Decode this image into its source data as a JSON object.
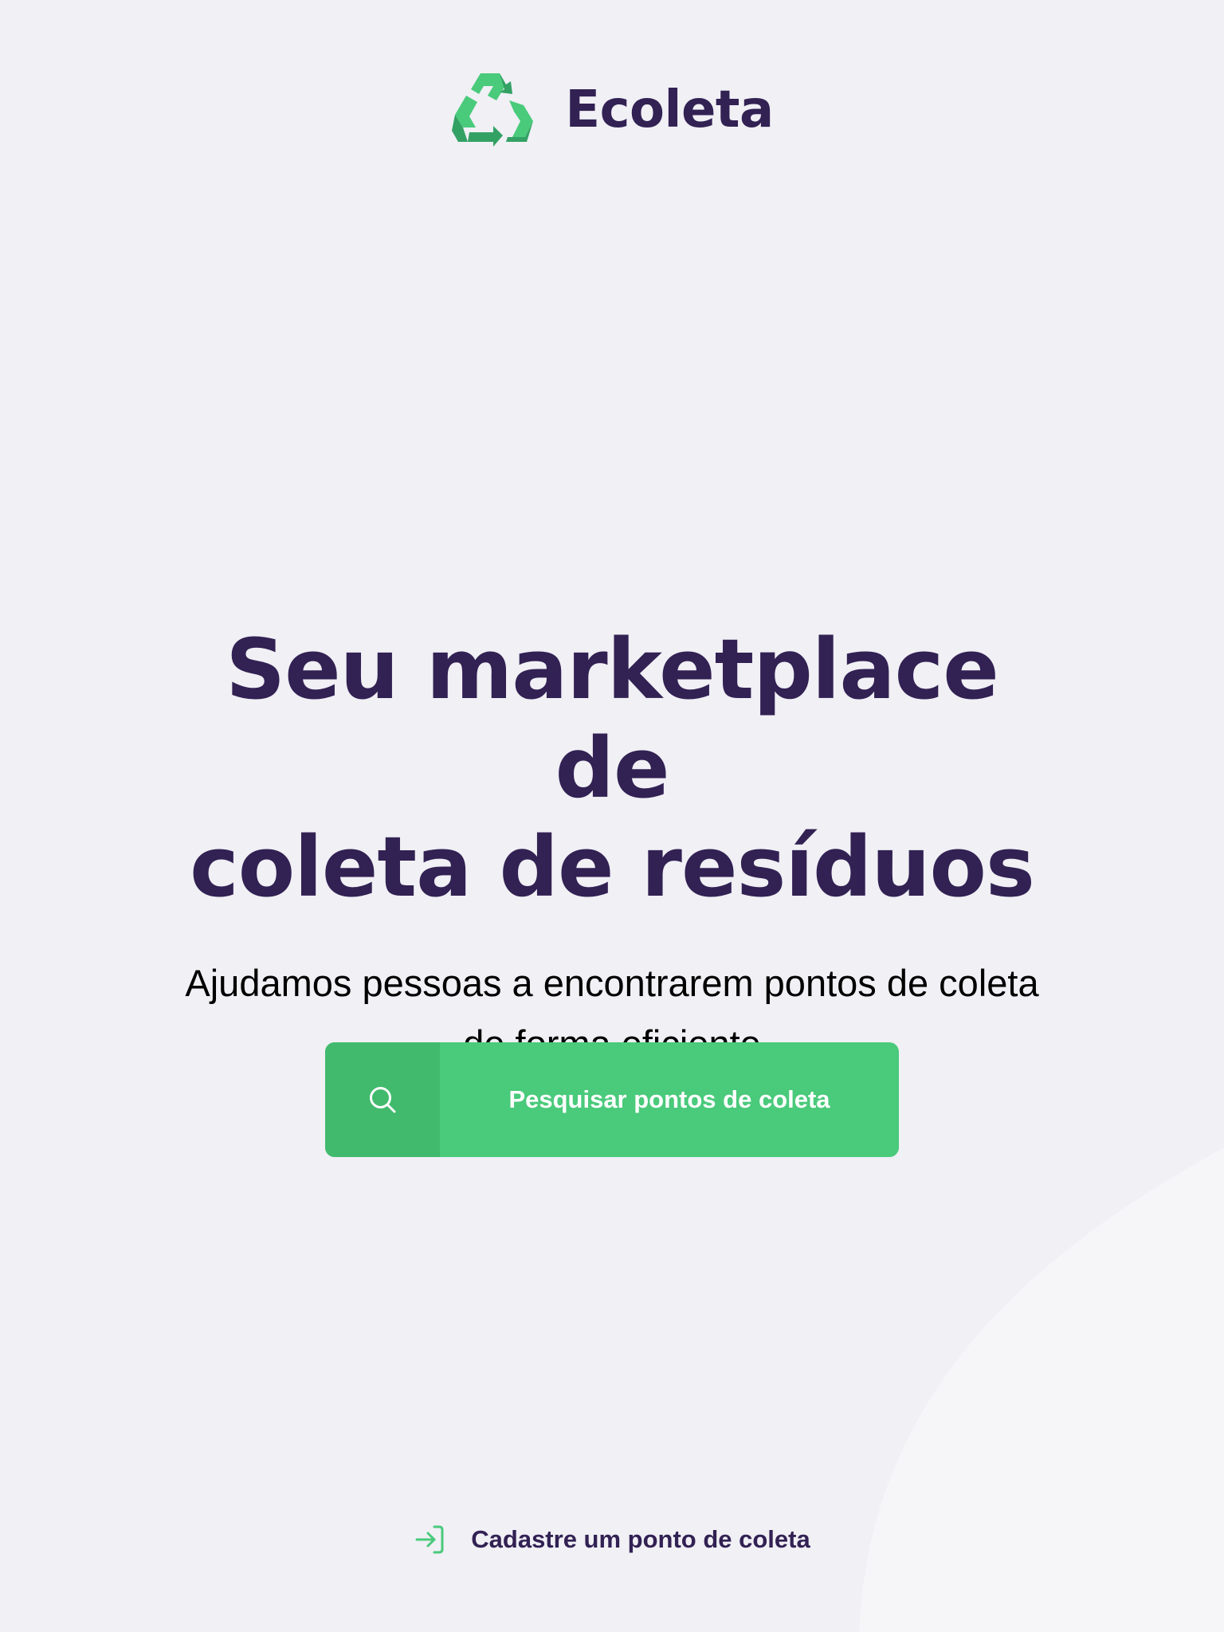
{
  "app": {
    "name": "Ecoleta",
    "logo_icon": "recycle-icon"
  },
  "hero": {
    "title_line1": "Seu marketplace de",
    "title_line2": "coleta de resíduos",
    "subtitle_line1": "Ajudamos pessoas a encontrarem pontos de coleta",
    "subtitle_line2": "de forma eficiente"
  },
  "search_button": {
    "label": "Pesquisar pontos de coleta",
    "icon": "search-icon"
  },
  "register_link": {
    "label": "Cadastre um ponto de coleta",
    "icon": "log-in-icon"
  },
  "colors": {
    "background": "#F0F0F5",
    "primary_text": "#322153",
    "accent_green": "#4ACA7B",
    "accent_green_dark": "#42BA6D",
    "logo_green_light": "#4ACA7B",
    "logo_green_dark": "#34A164"
  }
}
